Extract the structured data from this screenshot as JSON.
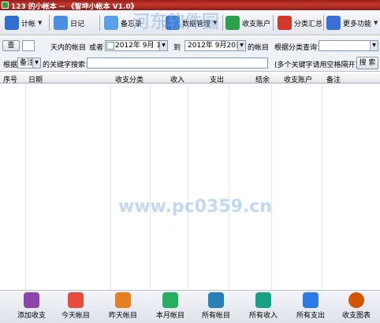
{
  "window": {
    "title": "123 的小帐本 -- 《智坤小帐本 V1.0》"
  },
  "toolbar": {
    "items": [
      {
        "label": "计帐",
        "icon": "calculator-icon",
        "color": "#2f6fd0"
      },
      {
        "label": "日记",
        "icon": "diary-icon",
        "color": "#4a8fe0"
      },
      {
        "label": "备忘录",
        "icon": "memo-icon",
        "color": "#5aa0e8"
      },
      {
        "label": "数据管理",
        "icon": "data-management-icon",
        "color": "#3d7ad6"
      },
      {
        "label": "收支账户",
        "icon": "account-icon",
        "color": "#2aa14a"
      },
      {
        "label": "分类汇总",
        "icon": "category-summary-icon",
        "color": "#d23b2b"
      },
      {
        "label": "更多功能",
        "icon": "more-functions-icon",
        "color": "#3b6fd8"
      }
    ]
  },
  "filter": {
    "query_button": "查",
    "days_label": "天内的帐目",
    "range_label": "或者",
    "start_date": "2012年 9月 1日",
    "to_label": "到",
    "end_date": "2012年 9月20日",
    "accounts_suffix": "的帐目",
    "category_label": "根据分类查询：",
    "category_value": ""
  },
  "search": {
    "by_label": "根据",
    "field_value": "备注",
    "keyword_label": "的关键字搜索：",
    "keyword_value": "",
    "hint": "(多个关键字请用空格隔开)",
    "button": "搜 索"
  },
  "table": {
    "columns": [
      "序号",
      "日期",
      "收支分类",
      "收入",
      "支出",
      "结余",
      "收支账户",
      "备注"
    ],
    "rows": []
  },
  "bottom": {
    "items": [
      {
        "label": "添加收支",
        "icon": "add-entry-icon",
        "color": "#8e44ad"
      },
      {
        "label": "今天帐目",
        "icon": "today-icon",
        "color": "#e74c3c"
      },
      {
        "label": "昨天帐目",
        "icon": "yesterday-icon",
        "color": "#e67e22"
      },
      {
        "label": "本月帐目",
        "icon": "this-month-icon",
        "color": "#27ae60"
      },
      {
        "label": "所有帐目",
        "icon": "all-entries-icon",
        "color": "#2980b9"
      },
      {
        "label": "所有收入",
        "icon": "all-income-icon",
        "color": "#16a085"
      },
      {
        "label": "所有支出",
        "icon": "all-expense-icon",
        "color": "#2c7be5"
      },
      {
        "label": "收支图表",
        "icon": "chart-icon",
        "color": "#d35400"
      }
    ]
  },
  "watermark": {
    "text": "河东软件园",
    "url": "www.pc0359.cn"
  }
}
